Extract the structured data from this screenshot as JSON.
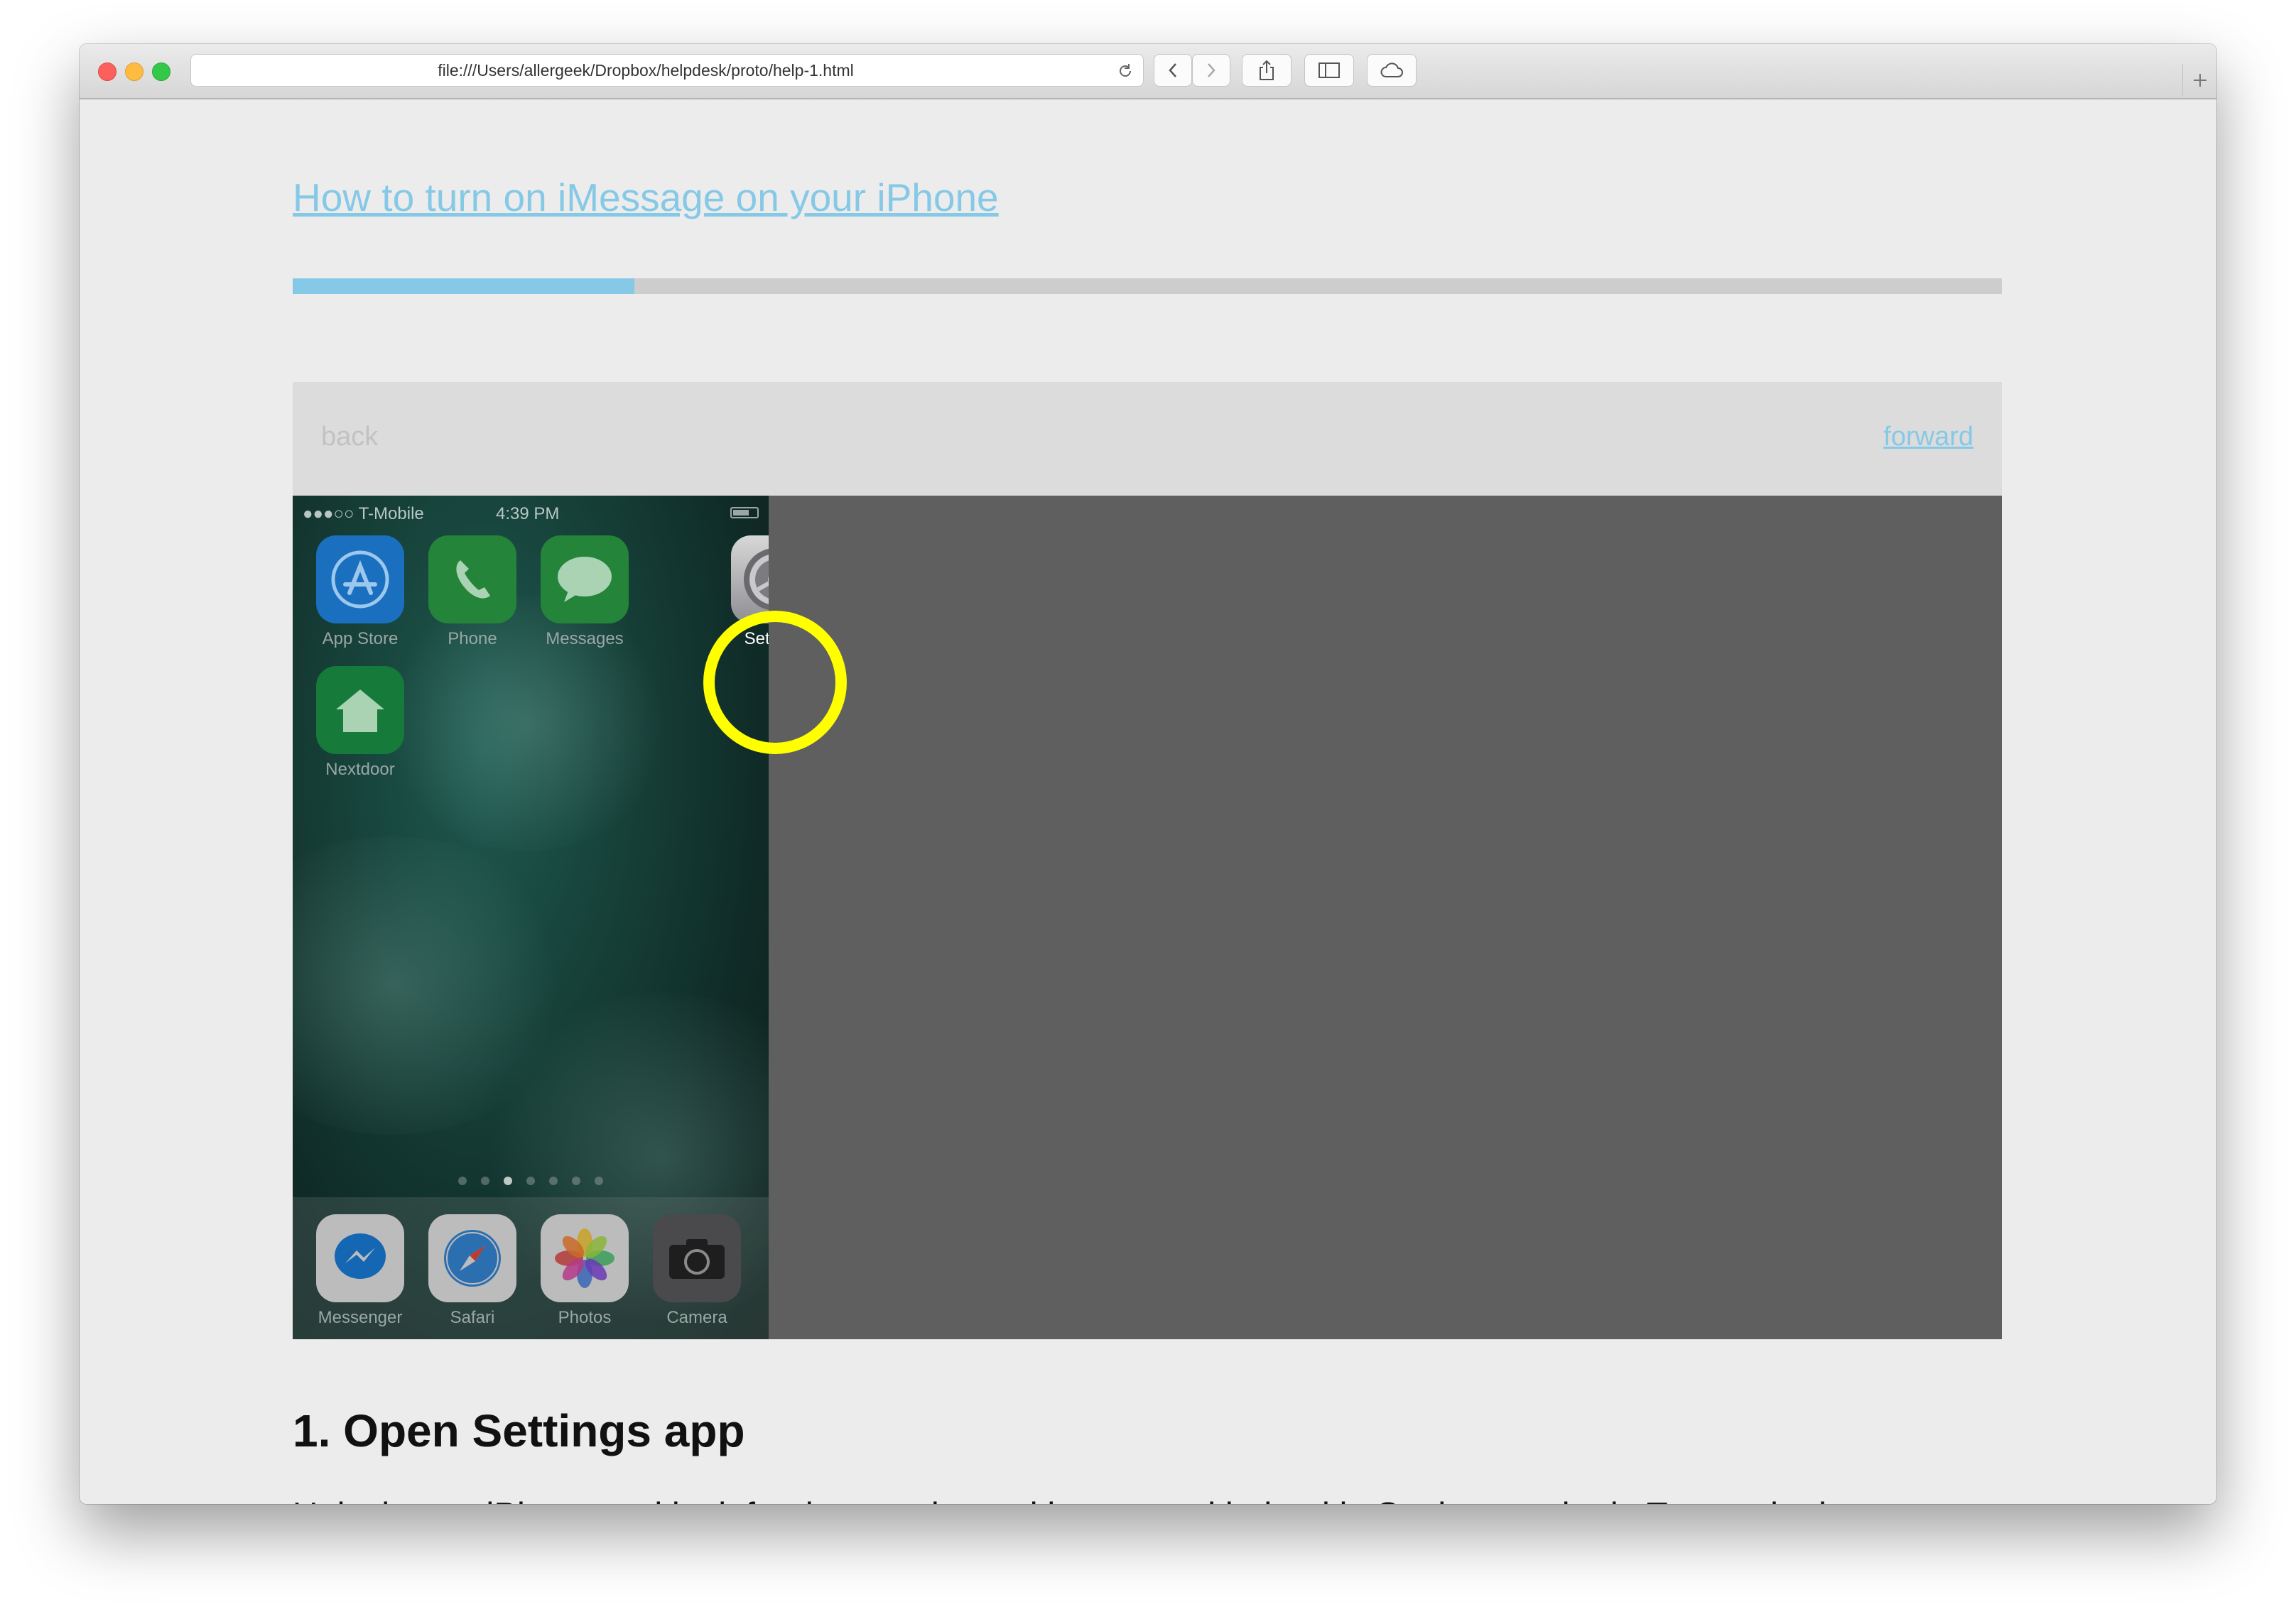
{
  "browser": {
    "url": "file:///Users/allergeek/Dropbox/helpdesk/proto/help-1.html"
  },
  "page": {
    "title_link": "How to turn on iMessage on your iPhone",
    "progress_fraction": 0.2,
    "nav": {
      "back_label": "back",
      "forward_label": "forward"
    },
    "step_title": "1. Open Settings app",
    "step_text": "Unlock your iPhone and look for the grey icon with gears, with the title Settings under it. Tap on the icon."
  },
  "phone": {
    "carrier": "●●●○○ T-Mobile",
    "time": "4:39 PM",
    "apps": [
      {
        "label": "App Store",
        "icon": "app-store-icon",
        "color": "#1a7fd6"
      },
      {
        "label": "Phone",
        "icon": "phone-icon",
        "color": "#2fba4a"
      },
      {
        "label": "Messages",
        "icon": "messages-icon",
        "color": "#2fba4a"
      },
      {
        "label": "Settings",
        "icon": "settings-gear-icon",
        "color": "#8e8e93"
      },
      {
        "label": "Nextdoor",
        "icon": "nextdoor-house-icon",
        "color": "#19a34a"
      }
    ],
    "dock": [
      {
        "label": "Messenger",
        "icon": "messenger-icon",
        "color": "#ffffff"
      },
      {
        "label": "Safari",
        "icon": "safari-compass-icon",
        "color": "#ffffff"
      },
      {
        "label": "Photos",
        "icon": "photos-flower-icon",
        "color": "#ffffff"
      },
      {
        "label": "Camera",
        "icon": "camera-icon",
        "color": "#3a3a3c"
      }
    ]
  },
  "colors": {
    "link": "#86c9e6",
    "highlight": "#ffff00",
    "screen_backdrop": "#5f5f5f"
  }
}
